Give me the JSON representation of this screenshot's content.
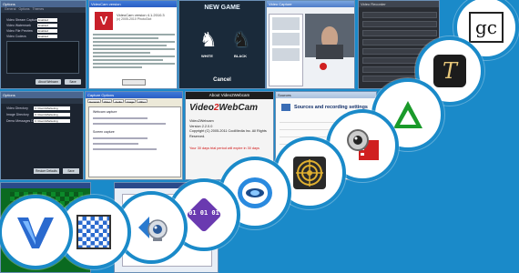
{
  "s1": {
    "title": "Options",
    "tabs": [
      "General",
      "Options",
      "Themes"
    ],
    "rows": [
      {
        "label": "Video Stream Capture",
        "value": "Enabled"
      },
      {
        "label": "Video Watermark",
        "value": "Enabled"
      },
      {
        "label": "Video File Preview",
        "value": "Enabled"
      },
      {
        "label": "Video Codecs",
        "value": "Enabled"
      }
    ],
    "buttons": [
      "About Webcam",
      "Save"
    ]
  },
  "s2": {
    "title": "VideoCam version",
    "version_line": "VideoCam version 4.1.2010.3",
    "copyright_line": "(c) 2005-2010 PhotoGlot"
  },
  "s3": {
    "title": "NEW GAME",
    "white_label": "WHITE",
    "black_label": "BLACK",
    "cancel_label": "Cancel"
  },
  "s4": {
    "title": "Video Capture"
  },
  "s5": {
    "title": "Video Recorder"
  },
  "s6": {
    "title": "Options",
    "rows": [
      {
        "label": "Video Directory",
        "value": "C:\\Users\\Marketing"
      },
      {
        "label": "Image Directory",
        "value": "C:\\Users\\Marketing"
      },
      {
        "label": "Demo Messages Directory",
        "value": "C:\\Users\\Marketing"
      }
    ],
    "buttons": [
      "Restore Defaults",
      "Save"
    ]
  },
  "s7": {
    "title": "Capture Options",
    "tabs": [
      "General",
      "Video",
      "Audio",
      "Image",
      "Other"
    ],
    "field1": "Webcam capture",
    "field2": "Screen capture"
  },
  "s8": {
    "title": "About Video2Webcam",
    "logo_a": "Video",
    "logo_b": "2",
    "logo_c": "WebCam",
    "product": "Video2Webcam",
    "version": "Version 2.2.0.0",
    "copyright": "Copyright (C) 2005-2011 CoolMedia Inc. All Rights Reserved.",
    "warning": "Your 30 days trial period will expire in 30 days"
  },
  "s9": {
    "title": "Sources",
    "header": "Sources and recording settings"
  },
  "icons": [
    {
      "name": "gc-icon",
      "label": "gc"
    },
    {
      "name": "text-t-icon",
      "label": "T"
    },
    {
      "name": "green-triangle-icon",
      "label": ""
    },
    {
      "name": "webcam-film-icon",
      "label": ""
    },
    {
      "name": "target-scope-icon",
      "label": ""
    },
    {
      "name": "blue-ring-icon",
      "label": ""
    },
    {
      "name": "binary-diamond-icon",
      "label": "01 01 01"
    },
    {
      "name": "webcam-arrow-icon",
      "label": ""
    },
    {
      "name": "chessboard-icon",
      "label": ""
    },
    {
      "name": "checkmark-v-icon",
      "label": ""
    }
  ],
  "colors": {
    "background": "#1a8ac9",
    "accent_red": "#d02020",
    "green": "#1a9a2a"
  }
}
